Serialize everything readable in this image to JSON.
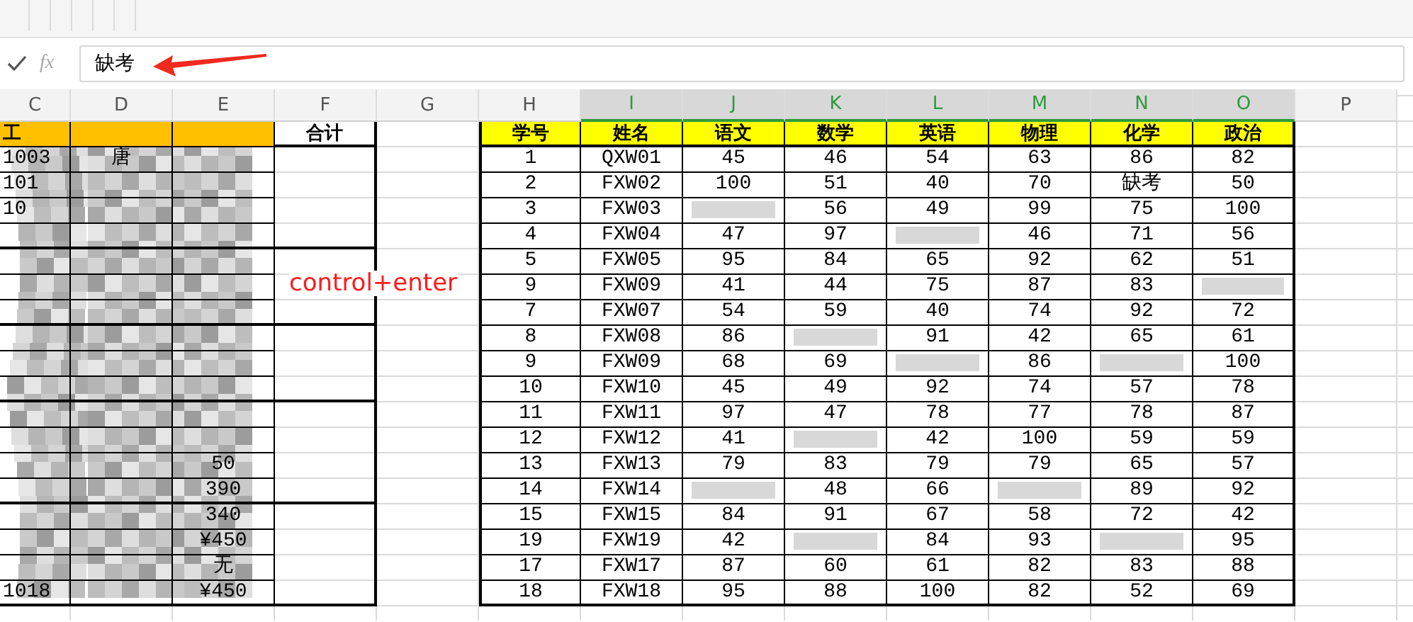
{
  "formula_bar": {
    "function_label": "fx",
    "value": "缺考"
  },
  "columns": [
    {
      "label": "C",
      "selected": false
    },
    {
      "label": "D",
      "selected": false
    },
    {
      "label": "E",
      "selected": false
    },
    {
      "label": "F",
      "selected": false
    },
    {
      "label": "G",
      "selected": false
    },
    {
      "label": "H",
      "selected": false
    },
    {
      "label": "I",
      "selected": true
    },
    {
      "label": "J",
      "selected": true
    },
    {
      "label": "K",
      "selected": true
    },
    {
      "label": "L",
      "selected": true
    },
    {
      "label": "M",
      "selected": true
    },
    {
      "label": "N",
      "selected": true
    },
    {
      "label": "O",
      "selected": true
    },
    {
      "label": "P",
      "selected": false
    }
  ],
  "left_table": {
    "headers": {
      "c": "工",
      "total": "合计"
    },
    "groups": [
      {
        "rows": [
          {
            "c": "1003",
            "d": "唐"
          },
          {
            "c": "101"
          },
          {
            "c": "10"
          },
          {}
        ]
      },
      {
        "rows": [
          {},
          {},
          {}
        ]
      },
      {
        "rows": [
          {},
          {},
          {}
        ]
      },
      {
        "rows": [
          {},
          {},
          {
            "e": "50"
          },
          {
            "e": "390"
          }
        ]
      },
      {
        "rows": [
          {
            "e": "340"
          },
          {
            "e": "¥450"
          },
          {
            "e": "无"
          },
          {
            "c": "1018",
            "e": "¥450"
          }
        ]
      }
    ]
  },
  "annotation": "control+enter",
  "score_table": {
    "headers": [
      "学号",
      "姓名",
      "语文",
      "数学",
      "英语",
      "物理",
      "化学",
      "政治"
    ],
    "rows": [
      {
        "no": "1",
        "name": "QXW01",
        "scores": [
          {
            "text": "45",
            "shaded": false
          },
          {
            "text": "46",
            "shaded": false
          },
          {
            "text": "54",
            "shaded": false
          },
          {
            "text": "63",
            "shaded": false
          },
          {
            "text": "86",
            "shaded": false
          },
          {
            "text": "82",
            "shaded": false
          }
        ]
      },
      {
        "no": "2",
        "name": "FXW02",
        "scores": [
          {
            "text": "100",
            "shaded": false
          },
          {
            "text": "51",
            "shaded": false
          },
          {
            "text": "40",
            "shaded": false
          },
          {
            "text": "70",
            "shaded": false
          },
          {
            "text": "缺考",
            "shaded": false
          },
          {
            "text": "50",
            "shaded": false
          }
        ]
      },
      {
        "no": "3",
        "name": "FXW03",
        "scores": [
          {
            "shaded": true
          },
          {
            "text": "56",
            "shaded": false
          },
          {
            "text": "49",
            "shaded": false
          },
          {
            "text": "99",
            "shaded": false
          },
          {
            "text": "75",
            "shaded": false
          },
          {
            "text": "100",
            "shaded": false
          }
        ]
      },
      {
        "no": "4",
        "name": "FXW04",
        "scores": [
          {
            "text": "47",
            "shaded": false
          },
          {
            "text": "97",
            "shaded": false
          },
          {
            "shaded": true
          },
          {
            "text": "46",
            "shaded": false
          },
          {
            "text": "71",
            "shaded": false
          },
          {
            "text": "56",
            "shaded": false
          }
        ]
      },
      {
        "no": "5",
        "name": "FXW05",
        "scores": [
          {
            "text": "95",
            "shaded": false
          },
          {
            "text": "84",
            "shaded": false
          },
          {
            "text": "65",
            "shaded": false
          },
          {
            "text": "92",
            "shaded": false
          },
          {
            "text": "62",
            "shaded": false
          },
          {
            "text": "51",
            "shaded": false
          }
        ]
      },
      {
        "no": "9",
        "name": "FXW09",
        "scores": [
          {
            "text": "41",
            "shaded": false
          },
          {
            "text": "44",
            "shaded": false
          },
          {
            "text": "75",
            "shaded": false
          },
          {
            "text": "87",
            "shaded": false
          },
          {
            "text": "83",
            "shaded": false
          },
          {
            "shaded": true
          }
        ]
      },
      {
        "no": "7",
        "name": "FXW07",
        "scores": [
          {
            "text": "54",
            "shaded": false
          },
          {
            "text": "59",
            "shaded": false
          },
          {
            "text": "40",
            "shaded": false
          },
          {
            "text": "74",
            "shaded": false
          },
          {
            "text": "92",
            "shaded": false
          },
          {
            "text": "72",
            "shaded": false
          }
        ]
      },
      {
        "no": "8",
        "name": "FXW08",
        "scores": [
          {
            "text": "86",
            "shaded": false
          },
          {
            "shaded": true
          },
          {
            "text": "91",
            "shaded": false
          },
          {
            "text": "42",
            "shaded": false
          },
          {
            "text": "65",
            "shaded": false
          },
          {
            "text": "61",
            "shaded": false
          }
        ]
      },
      {
        "no": "9",
        "name": "FXW09",
        "scores": [
          {
            "text": "68",
            "shaded": false
          },
          {
            "text": "69",
            "shaded": false
          },
          {
            "shaded": true
          },
          {
            "text": "86",
            "shaded": false
          },
          {
            "shaded": true
          },
          {
            "text": "100",
            "shaded": false
          }
        ]
      },
      {
        "no": "10",
        "name": "FXW10",
        "scores": [
          {
            "text": "45",
            "shaded": false
          },
          {
            "text": "49",
            "shaded": false
          },
          {
            "text": "92",
            "shaded": false
          },
          {
            "text": "74",
            "shaded": false
          },
          {
            "text": "57",
            "shaded": false
          },
          {
            "text": "78",
            "shaded": false
          }
        ]
      },
      {
        "no": "11",
        "name": "FXW11",
        "scores": [
          {
            "text": "97",
            "shaded": false
          },
          {
            "text": "47",
            "shaded": false
          },
          {
            "text": "78",
            "shaded": false
          },
          {
            "text": "77",
            "shaded": false
          },
          {
            "text": "78",
            "shaded": false
          },
          {
            "text": "87",
            "shaded": false
          }
        ]
      },
      {
        "no": "12",
        "name": "FXW12",
        "scores": [
          {
            "text": "41",
            "shaded": false
          },
          {
            "shaded": true
          },
          {
            "text": "42",
            "shaded": false
          },
          {
            "text": "100",
            "shaded": false
          },
          {
            "text": "59",
            "shaded": false
          },
          {
            "text": "59",
            "shaded": false
          }
        ]
      },
      {
        "no": "13",
        "name": "FXW13",
        "scores": [
          {
            "text": "79",
            "shaded": false
          },
          {
            "text": "83",
            "shaded": false
          },
          {
            "text": "79",
            "shaded": false
          },
          {
            "text": "79",
            "shaded": false
          },
          {
            "text": "65",
            "shaded": false
          },
          {
            "text": "57",
            "shaded": false
          }
        ]
      },
      {
        "no": "14",
        "name": "FXW14",
        "scores": [
          {
            "shaded": true
          },
          {
            "text": "48",
            "shaded": false
          },
          {
            "text": "66",
            "shaded": false
          },
          {
            "shaded": true
          },
          {
            "text": "89",
            "shaded": false
          },
          {
            "text": "92",
            "shaded": false
          }
        ]
      },
      {
        "no": "15",
        "name": "FXW15",
        "scores": [
          {
            "text": "84",
            "shaded": false
          },
          {
            "text": "91",
            "shaded": false
          },
          {
            "text": "67",
            "shaded": false
          },
          {
            "text": "58",
            "shaded": false
          },
          {
            "text": "72",
            "shaded": false
          },
          {
            "text": "42",
            "shaded": false
          }
        ]
      },
      {
        "no": "19",
        "name": "FXW19",
        "scores": [
          {
            "text": "42",
            "shaded": false
          },
          {
            "shaded": true
          },
          {
            "text": "84",
            "shaded": false
          },
          {
            "text": "93",
            "shaded": false
          },
          {
            "shaded": true
          },
          {
            "text": "95",
            "shaded": false
          }
        ]
      },
      {
        "no": "17",
        "name": "FXW17",
        "scores": [
          {
            "text": "87",
            "shaded": false
          },
          {
            "text": "60",
            "shaded": false
          },
          {
            "text": "61",
            "shaded": false
          },
          {
            "text": "82",
            "shaded": false
          },
          {
            "text": "83",
            "shaded": false
          },
          {
            "text": "88",
            "shaded": false
          }
        ]
      },
      {
        "no": "18",
        "name": "FXW18",
        "scores": [
          {
            "text": "95",
            "shaded": false
          },
          {
            "text": "88",
            "shaded": false
          },
          {
            "text": "100",
            "shaded": false
          },
          {
            "text": "82",
            "shaded": false
          },
          {
            "text": "52",
            "shaded": false
          },
          {
            "text": "69",
            "shaded": false
          }
        ]
      }
    ]
  }
}
